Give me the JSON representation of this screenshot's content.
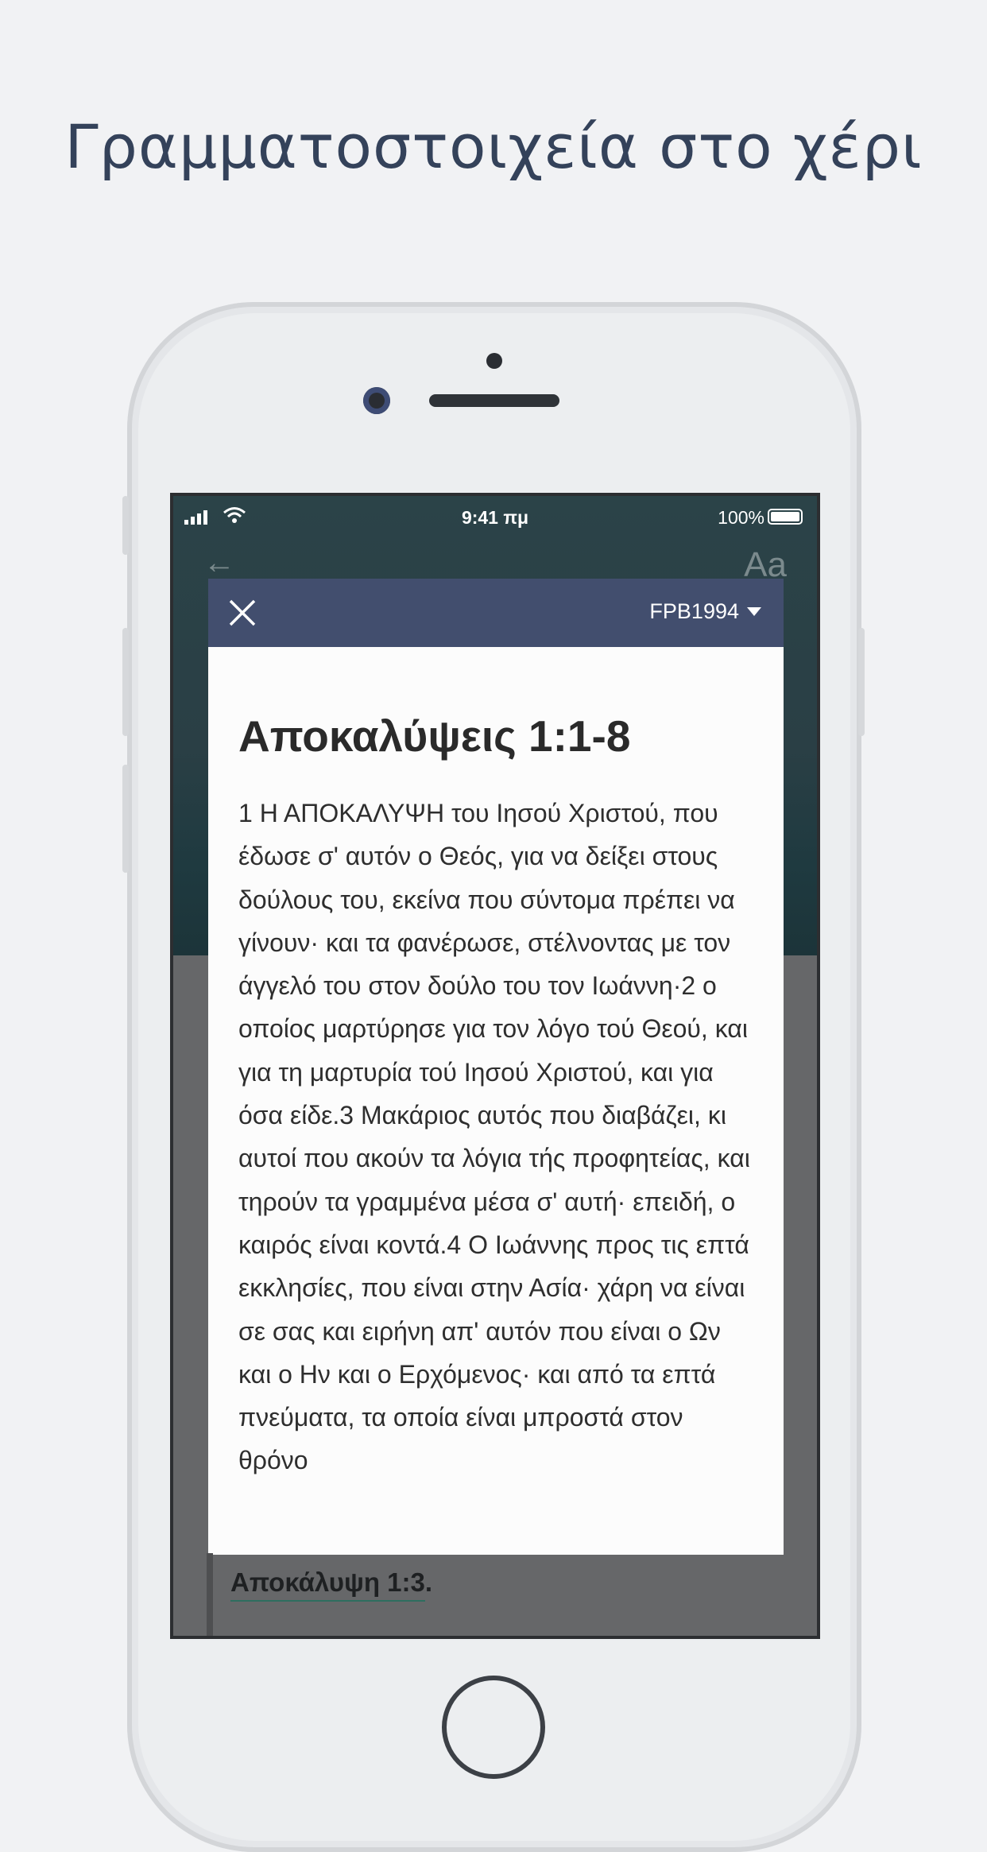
{
  "headline": "Γραμματοστοιχεία στο χέρι",
  "status_bar": {
    "time": "9:41 πμ",
    "battery": "100%",
    "icons": [
      "signal-icon",
      "wifi-icon",
      "battery-icon"
    ]
  },
  "background_app": {
    "back_icon": "arrow-left-icon",
    "font_icon": "Aa",
    "link_text": "Αποκάλυψη 1:3",
    "link_suffix": "."
  },
  "modal": {
    "close_icon": "close-icon",
    "version": "FPB1994",
    "title": "Αποκαλύψεις 1:1-8",
    "text": "1 Η ΑΠΟΚΑΛΥΨΗ του Ιησού Χριστού, που έδωσε σ' αυτόν ο Θεός, για να δείξει στους δούλους του, εκείνα που σύντομα πρέπει να γίνουν· και τα φανέρωσε, στέλνοντας με τον άγγελό του στον δούλο του τον Ιωάννη·2 ο οποίος μαρτύρησε για τον λόγο τού Θεού, και για τη μαρτυρία τού Ιησού Χριστού, και για όσα είδε.3 Μακάριος αυτός που διαβάζει, κι αυτοί που ακούν τα λόγια τής προφητείας, και τηρούν τα γραμμένα μέσα σ' αυτή· επειδή, ο καιρός είναι κοντά.4 Ο Ιωάννης προς τις επτά εκκλησίες, που είναι στην Ασία· χάρη να είναι σε σας και ειρήνη απ' αυτόν που είναι ο Ων και ο Ην και ο Ερχόμενος· και από τα επτά πνεύματα, τα οποία είναι μπροστά στον θρόνο"
  },
  "colors": {
    "header": "#424e6e",
    "headline": "#34425a",
    "overlay": "#666769"
  }
}
